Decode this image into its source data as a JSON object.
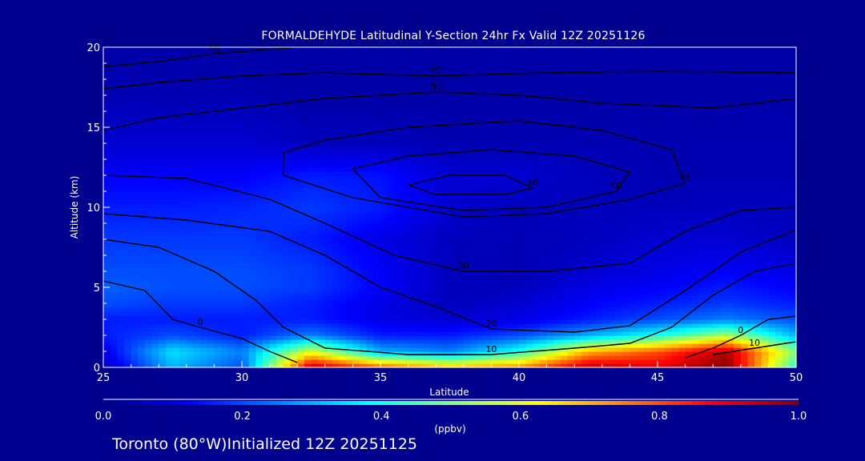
{
  "chart_data": {
    "type": "heatmap",
    "title": "FORMALDEHYDE Latitudinal Y-Section 24hr  Fx Valid 12Z 20251126",
    "xlabel": "Latitude",
    "ylabel": "Altitude (km)",
    "xlim": [
      25,
      50
    ],
    "ylim": [
      0,
      20
    ],
    "x_ticks": [
      "25",
      "30",
      "35",
      "40",
      "45",
      "50"
    ],
    "y_ticks": [
      "0",
      "5",
      "10",
      "15",
      "20"
    ],
    "colorbar": {
      "min": 0.0,
      "max": 1.0,
      "ticks": [
        "0.0",
        "0.2",
        "0.4",
        "0.6",
        "0.8",
        "1.0"
      ],
      "unit": "(ppbv)",
      "colors": [
        "#000080",
        "#0000ff",
        "#0080ff",
        "#00ffff",
        "#80ff80",
        "#ffff00",
        "#ff8000",
        "#ff0000",
        "#800000"
      ]
    },
    "x": [
      25,
      27.5,
      30,
      32.5,
      35,
      37.5,
      40,
      42.5,
      45,
      47.5,
      50
    ],
    "y": [
      0,
      1,
      2,
      3,
      4,
      5,
      6,
      8,
      10,
      12,
      14,
      17,
      20
    ],
    "z": [
      [
        0.05,
        0.3,
        0.2,
        0.95,
        0.8,
        0.7,
        0.75,
        0.95,
        0.9,
        1.0,
        0.4
      ],
      [
        0.1,
        0.35,
        0.25,
        0.6,
        0.3,
        0.25,
        0.4,
        0.7,
        0.8,
        0.95,
        0.5
      ],
      [
        0.15,
        0.2,
        0.15,
        0.25,
        0.15,
        0.15,
        0.2,
        0.3,
        0.4,
        0.55,
        0.3
      ],
      [
        0.15,
        0.15,
        0.15,
        0.15,
        0.1,
        0.08,
        0.1,
        0.15,
        0.2,
        0.25,
        0.2
      ],
      [
        0.2,
        0.18,
        0.18,
        0.15,
        0.1,
        0.06,
        0.08,
        0.12,
        0.15,
        0.18,
        0.15
      ],
      [
        0.22,
        0.2,
        0.2,
        0.18,
        0.12,
        0.06,
        0.06,
        0.1,
        0.12,
        0.15,
        0.12
      ],
      [
        0.2,
        0.2,
        0.2,
        0.18,
        0.12,
        0.06,
        0.05,
        0.08,
        0.1,
        0.12,
        0.1
      ],
      [
        0.18,
        0.18,
        0.18,
        0.15,
        0.1,
        0.06,
        0.05,
        0.06,
        0.08,
        0.08,
        0.06
      ],
      [
        0.15,
        0.15,
        0.16,
        0.18,
        0.15,
        0.08,
        0.06,
        0.06,
        0.06,
        0.06,
        0.06
      ],
      [
        0.12,
        0.12,
        0.12,
        0.15,
        0.14,
        0.08,
        0.08,
        0.06,
        0.05,
        0.05,
        0.05
      ],
      [
        0.08,
        0.08,
        0.08,
        0.06,
        0.06,
        0.05,
        0.05,
        0.05,
        0.05,
        0.05,
        0.05
      ],
      [
        0.05,
        0.05,
        0.05,
        0.04,
        0.04,
        0.04,
        0.04,
        0.04,
        0.04,
        0.04,
        0.04
      ],
      [
        0.04,
        0.04,
        0.04,
        0.04,
        0.04,
        0.04,
        0.04,
        0.04,
        0.04,
        0.04,
        0.04
      ]
    ],
    "contours": [
      {
        "label": "10",
        "points": [
          [
            25,
            18.8
          ],
          [
            27,
            19.1
          ],
          [
            29,
            19.6
          ],
          [
            32,
            20
          ]
        ]
      },
      {
        "label": "20",
        "points": [
          [
            25,
            17.4
          ],
          [
            27,
            17.8
          ],
          [
            30,
            18.2
          ],
          [
            33,
            18.4
          ],
          [
            37,
            18.2
          ],
          [
            41,
            18.4
          ],
          [
            45,
            18.5
          ],
          [
            50,
            18.4
          ]
        ]
      },
      {
        "label": "30",
        "points": [
          [
            25,
            14.8
          ],
          [
            27,
            15.6
          ],
          [
            30,
            16.2
          ],
          [
            33,
            16.8
          ],
          [
            37,
            17.2
          ],
          [
            40,
            17.0
          ],
          [
            43,
            16.5
          ],
          [
            47,
            16.2
          ],
          [
            50,
            16.8
          ]
        ]
      },
      {
        "label": "40",
        "points": [
          [
            31.5,
            13.4
          ],
          [
            33,
            14.2
          ],
          [
            36,
            15.0
          ],
          [
            40,
            15.4
          ],
          [
            43,
            14.8
          ],
          [
            45.5,
            13.6
          ],
          [
            46,
            11.5
          ],
          [
            44,
            10.5
          ],
          [
            41,
            9.6
          ],
          [
            38,
            9.4
          ],
          [
            34,
            10.6
          ],
          [
            31.5,
            12.0
          ],
          [
            31.5,
            13.4
          ]
        ]
      },
      {
        "label": "50",
        "points": [
          [
            34,
            12.4
          ],
          [
            36,
            13.2
          ],
          [
            39,
            13.6
          ],
          [
            42,
            13.2
          ],
          [
            44,
            12.2
          ],
          [
            43.5,
            11.0
          ],
          [
            41,
            10.0
          ],
          [
            38,
            9.8
          ],
          [
            35,
            10.6
          ],
          [
            34,
            12.4
          ]
        ]
      },
      {
        "label": "60",
        "points": [
          [
            36,
            11.4
          ],
          [
            37.5,
            12.0
          ],
          [
            39.5,
            12.0
          ],
          [
            40.5,
            11.2
          ],
          [
            39.5,
            10.8
          ],
          [
            37,
            10.8
          ],
          [
            36,
            11.4
          ]
        ]
      },
      {
        "label": "30",
        "points": [
          [
            25,
            12.0
          ],
          [
            28,
            11.8
          ],
          [
            31,
            10.5
          ],
          [
            33,
            9.0
          ],
          [
            35.5,
            7.0
          ],
          [
            38,
            6.0
          ],
          [
            41,
            6.0
          ],
          [
            44,
            6.5
          ],
          [
            46,
            8.5
          ],
          [
            48,
            9.8
          ],
          [
            50,
            10.0
          ]
        ]
      },
      {
        "label": "20",
        "points": [
          [
            25,
            9.6
          ],
          [
            28,
            9.2
          ],
          [
            31,
            8.5
          ],
          [
            33,
            7.0
          ],
          [
            35,
            5.0
          ],
          [
            37,
            3.8
          ],
          [
            39,
            2.4
          ],
          [
            42,
            2.2
          ],
          [
            44,
            2.6
          ],
          [
            46,
            4.8
          ],
          [
            48,
            7.2
          ],
          [
            50,
            8.6
          ]
        ]
      },
      {
        "label": "10",
        "points": [
          [
            25,
            8.0
          ],
          [
            27,
            7.5
          ],
          [
            29,
            6.0
          ],
          [
            30.5,
            4.2
          ],
          [
            31.5,
            2.5
          ],
          [
            33,
            1.2
          ],
          [
            36,
            0.8
          ],
          [
            39,
            0.8
          ],
          [
            42,
            1.2
          ],
          [
            44,
            1.5
          ],
          [
            45.5,
            2.5
          ],
          [
            47,
            4.5
          ],
          [
            48.5,
            6.0
          ],
          [
            50,
            6.5
          ]
        ]
      },
      {
        "label": "0",
        "points": [
          [
            25,
            5.4
          ],
          [
            26.5,
            4.8
          ],
          [
            27.5,
            3.0
          ],
          [
            28.5,
            2.5
          ],
          [
            30,
            1.8
          ],
          [
            31,
            1.0
          ],
          [
            32,
            0.3
          ]
        ]
      },
      {
        "label": "0",
        "points": [
          [
            46,
            0.6
          ],
          [
            47,
            1.2
          ],
          [
            48,
            2.0
          ],
          [
            49,
            3.0
          ],
          [
            50,
            3.2
          ]
        ]
      },
      {
        "label": "10",
        "points": [
          [
            47,
            0.8
          ],
          [
            48.5,
            1.2
          ],
          [
            50,
            1.6
          ]
        ]
      }
    ]
  },
  "footer": {
    "location": "Toronto (80°W)Initialized 12Z 20251125"
  }
}
